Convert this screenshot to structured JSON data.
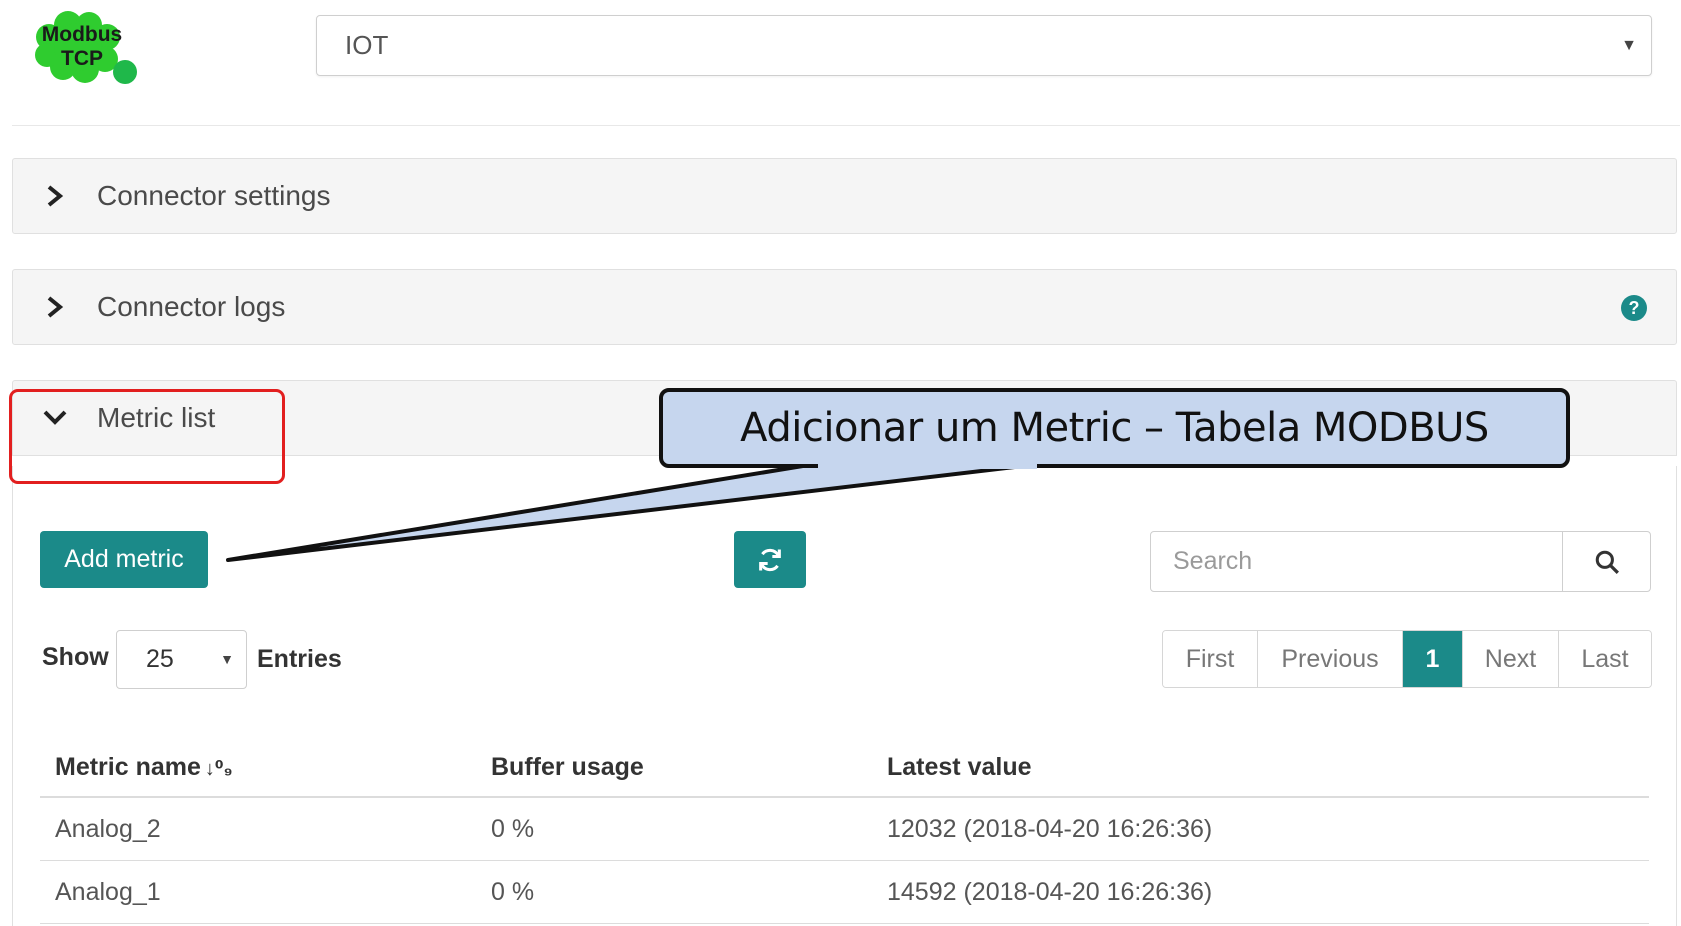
{
  "logo": {
    "line1": "Modbus",
    "line2": "TCP",
    "color": "#2fcc2f"
  },
  "device_select": {
    "value": "IOT"
  },
  "panels": {
    "connector_settings": {
      "title": "Connector settings"
    },
    "connector_logs": {
      "title": "Connector logs",
      "help": "?"
    },
    "metric_list": {
      "title": "Metric list"
    }
  },
  "toolbar": {
    "add_label": "Add metric",
    "search_placeholder": "Search"
  },
  "length": {
    "show_label": "Show",
    "value": "25",
    "entries_label": "Entries"
  },
  "pagination": {
    "first": "First",
    "previous": "Previous",
    "current": "1",
    "next": "Next",
    "last": "Last"
  },
  "table": {
    "headers": [
      "Metric name",
      "Buffer usage",
      "Latest value"
    ],
    "rows": [
      [
        "Analog_2",
        "0 %",
        "12032 (2018-04-20 16:26:36)"
      ],
      [
        "Analog_1",
        "0 %",
        "14592 (2018-04-20 16:26:36)"
      ]
    ]
  },
  "annotation": {
    "callout_text": "Adicionar um Metric – Tabela MODBUS"
  },
  "colors": {
    "accent": "#1b8a89",
    "highlight": "#e21f1f",
    "callout_fill": "#c6d6ee"
  }
}
